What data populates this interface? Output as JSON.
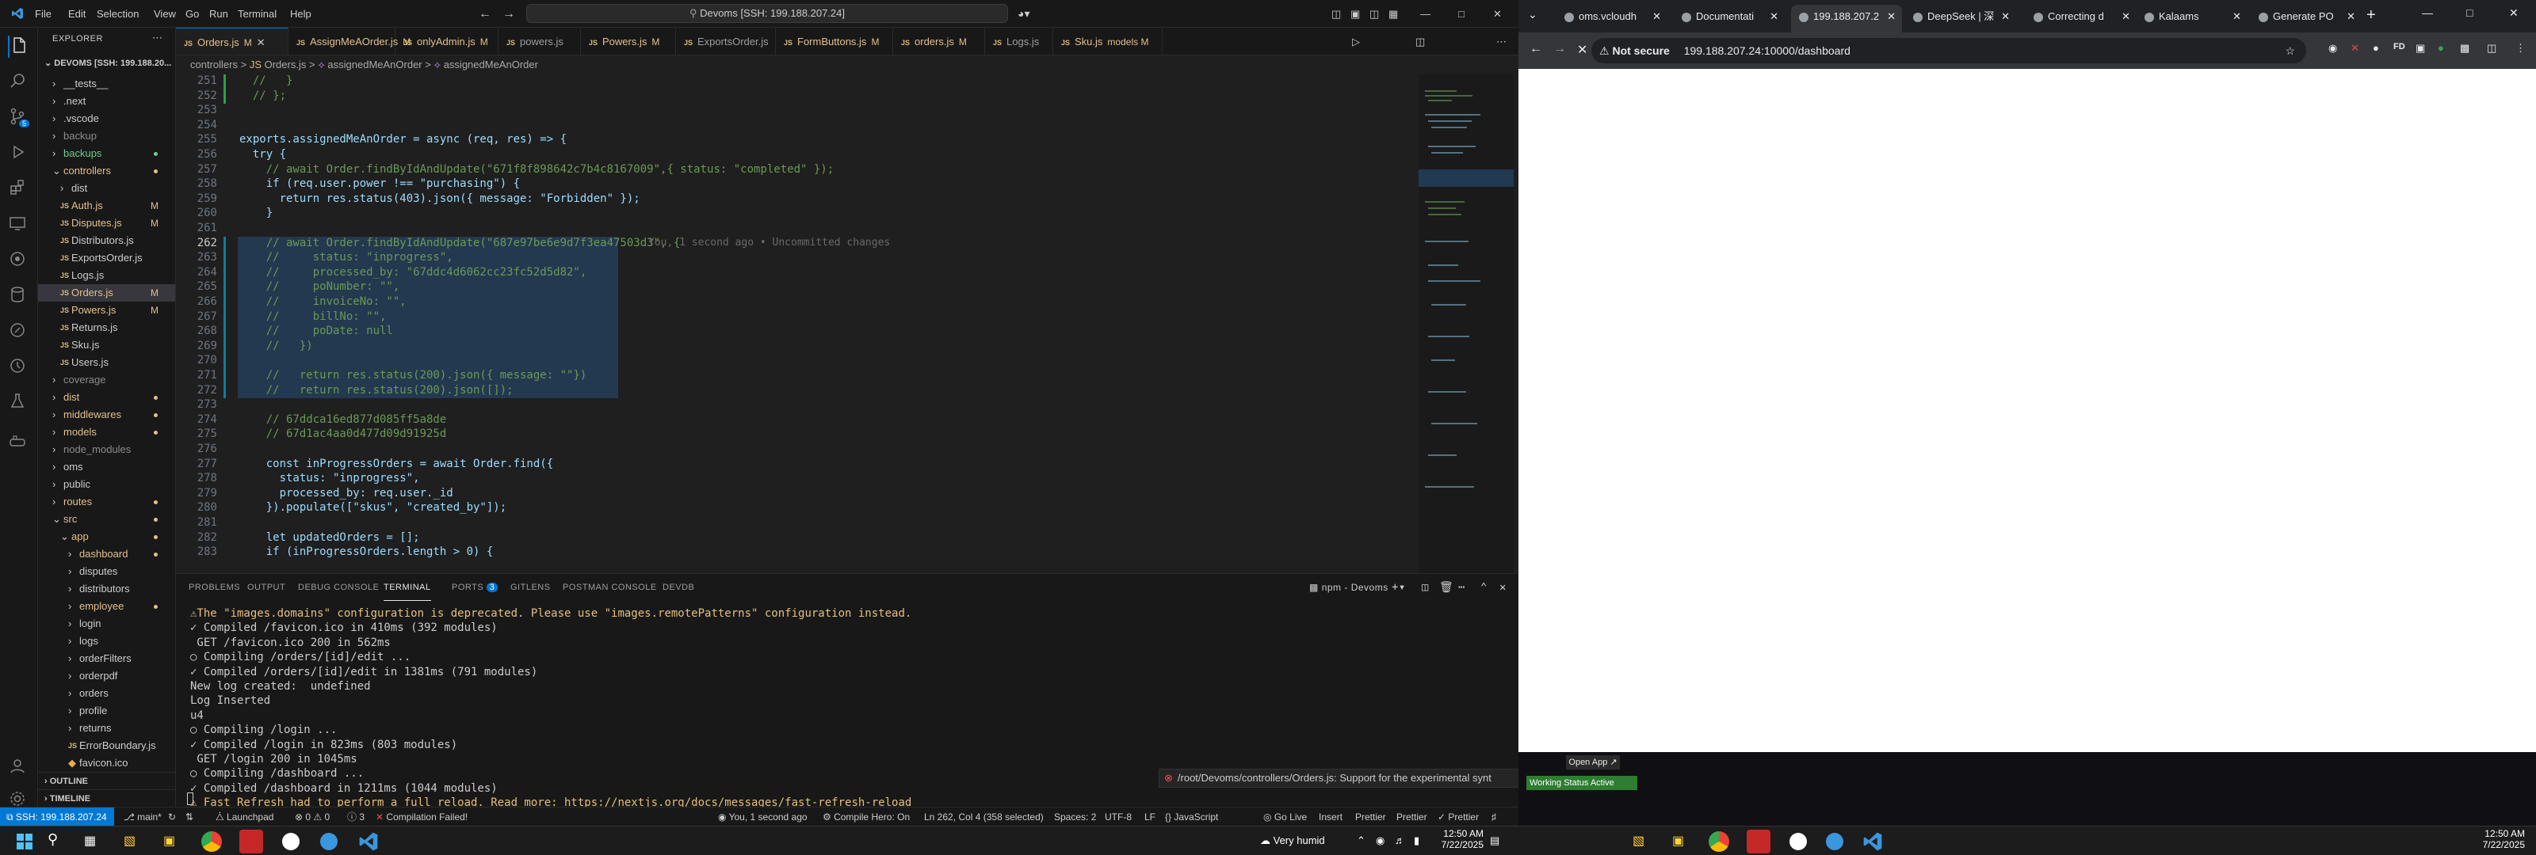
{
  "vscode": {
    "menu": [
      "File",
      "Edit",
      "Selection",
      "View",
      "Go",
      "Run",
      "Terminal",
      "Help"
    ],
    "command_center": "Devoms [SSH: 199.188.207.24]",
    "explorer": {
      "header": "EXPLORER",
      "root": "DEVOMS [SSH: 199.188.20...",
      "items": [
        {
          "label": "__tests__",
          "depth": 1,
          "type": "folder",
          "color": "#cccccc"
        },
        {
          "label": ".next",
          "depth": 1,
          "type": "folder",
          "color": "#cccccc"
        },
        {
          "label": ".vscode",
          "depth": 1,
          "type": "folder",
          "color": "#cccccc"
        },
        {
          "label": "backup",
          "depth": 1,
          "type": "folder",
          "color": "#8c8c8c"
        },
        {
          "label": "backups",
          "depth": 1,
          "type": "folder",
          "color": "#73c991"
        },
        {
          "label": "controllers",
          "depth": 1,
          "type": "folder-open",
          "color": "#e2c08d"
        },
        {
          "label": "dist",
          "depth": 2,
          "type": "folder",
          "color": "#cccccc"
        },
        {
          "label": "Auth.js",
          "depth": 2,
          "type": "js",
          "color": "#e2c08d",
          "badge": "M"
        },
        {
          "label": "Disputes.js",
          "depth": 2,
          "type": "js",
          "color": "#e2c08d",
          "badge": "M"
        },
        {
          "label": "Distributors.js",
          "depth": 2,
          "type": "js",
          "color": "#cccccc"
        },
        {
          "label": "ExportsOrder.js",
          "depth": 2,
          "type": "js",
          "color": "#cccccc"
        },
        {
          "label": "Logs.js",
          "depth": 2,
          "type": "js",
          "color": "#cccccc"
        },
        {
          "label": "Orders.js",
          "depth": 2,
          "type": "js",
          "color": "#e2c08d",
          "badge": "M",
          "selected": true
        },
        {
          "label": "Powers.js",
          "depth": 2,
          "type": "js",
          "color": "#e2c08d",
          "badge": "M"
        },
        {
          "label": "Returns.js",
          "depth": 2,
          "type": "js",
          "color": "#cccccc"
        },
        {
          "label": "Sku.js",
          "depth": 2,
          "type": "js",
          "color": "#cccccc"
        },
        {
          "label": "Users.js",
          "depth": 2,
          "type": "js",
          "color": "#cccccc"
        },
        {
          "label": "coverage",
          "depth": 1,
          "type": "folder",
          "color": "#8c8c8c"
        },
        {
          "label": "dist",
          "depth": 1,
          "type": "folder",
          "color": "#e2c08d"
        },
        {
          "label": "middlewares",
          "depth": 1,
          "type": "folder",
          "color": "#e2c08d"
        },
        {
          "label": "models",
          "depth": 1,
          "type": "folder",
          "color": "#e2c08d"
        },
        {
          "label": "node_modules",
          "depth": 1,
          "type": "folder",
          "color": "#8c8c8c"
        },
        {
          "label": "oms",
          "depth": 1,
          "type": "folder",
          "color": "#cccccc"
        },
        {
          "label": "public",
          "depth": 1,
          "type": "folder",
          "color": "#cccccc"
        },
        {
          "label": "routes",
          "depth": 1,
          "type": "folder",
          "color": "#e2c08d"
        },
        {
          "label": "src",
          "depth": 1,
          "type": "folder-open",
          "color": "#e2c08d"
        },
        {
          "label": "app",
          "depth": 2,
          "type": "folder-open",
          "color": "#e2c08d"
        },
        {
          "label": "dashboard",
          "depth": 3,
          "type": "folder",
          "color": "#e2c08d"
        },
        {
          "label": "disputes",
          "depth": 3,
          "type": "folder",
          "color": "#cccccc"
        },
        {
          "label": "distributors",
          "depth": 3,
          "type": "folder",
          "color": "#cccccc"
        },
        {
          "label": "employee",
          "depth": 3,
          "type": "folder",
          "color": "#e2c08d"
        },
        {
          "label": "login",
          "depth": 3,
          "type": "folder",
          "color": "#cccccc"
        },
        {
          "label": "logs",
          "depth": 3,
          "type": "folder",
          "color": "#cccccc"
        },
        {
          "label": "orderFilters",
          "depth": 3,
          "type": "folder",
          "color": "#cccccc"
        },
        {
          "label": "orderpdf",
          "depth": 3,
          "type": "folder",
          "color": "#cccccc"
        },
        {
          "label": "orders",
          "depth": 3,
          "type": "folder",
          "color": "#cccccc"
        },
        {
          "label": "profile",
          "depth": 3,
          "type": "folder",
          "color": "#cccccc"
        },
        {
          "label": "returns",
          "depth": 3,
          "type": "folder",
          "color": "#cccccc"
        },
        {
          "label": "ErrorBoundary.js",
          "depth": 3,
          "type": "js",
          "color": "#cccccc"
        },
        {
          "label": "favicon.ico",
          "depth": 3,
          "type": "file",
          "color": "#cccccc"
        }
      ],
      "outline": "OUTLINE",
      "timeline": "TIMELINE"
    },
    "tabs": [
      {
        "label": "Orders.js",
        "badge": "M",
        "active": true
      },
      {
        "label": "AssignMeAOrder.js",
        "badge": "M"
      },
      {
        "label": "onlyAdmin.js",
        "badge": "M"
      },
      {
        "label": "powers.js",
        "badge": ""
      },
      {
        "label": "Powers.js",
        "badge": "M"
      },
      {
        "label": "ExportsOrder.js",
        "badge": ""
      },
      {
        "label": "FormButtons.js",
        "badge": "M"
      },
      {
        "label": "orders.js",
        "badge": "M"
      },
      {
        "label": "Logs.js",
        "badge": ""
      },
      {
        "label": "Sku.js",
        "badge": "models M"
      }
    ],
    "breadcrumbs": [
      "controllers",
      ">",
      "Orders.js",
      ">",
      "assignedMeAnOrder",
      ">",
      "assignedMeAnOrder"
    ],
    "code_lines": [
      {
        "n": "251",
        "t": "  //   }"
      },
      {
        "n": "252",
        "t": "  // };"
      },
      {
        "n": "253",
        "t": ""
      },
      {
        "n": "254",
        "t": ""
      },
      {
        "n": "255",
        "t": "exports.assignedMeAnOrder = async (req, res) => {"
      },
      {
        "n": "256",
        "t": "  try {"
      },
      {
        "n": "257",
        "t": "    // await Order.findByIdAndUpdate(\"671f8f898642c7b4c8167009\",{ status: \"completed\" });"
      },
      {
        "n": "258",
        "t": "    if (req.user.power !== \"purchasing\") {"
      },
      {
        "n": "259",
        "t": "      return res.status(403).json({ message: \"Forbidden\" });"
      },
      {
        "n": "260",
        "t": "    }"
      },
      {
        "n": "261",
        "t": ""
      },
      {
        "n": "262",
        "t": "    // await Order.findByIdAndUpdate(\"687e97be6e9d7f3ea47503d3\", {"
      },
      {
        "n": "263",
        "t": "    //     status: \"inprogress\","
      },
      {
        "n": "264",
        "t": "    //     processed_by: \"67ddc4d6062cc23fc52d5d82\","
      },
      {
        "n": "265",
        "t": "    //     poNumber: \"\","
      },
      {
        "n": "266",
        "t": "    //     invoiceNo: \"\","
      },
      {
        "n": "267",
        "t": "    //     billNo: \"\","
      },
      {
        "n": "268",
        "t": "    //     poDate: null"
      },
      {
        "n": "269",
        "t": "    //   })"
      },
      {
        "n": "270",
        "t": ""
      },
      {
        "n": "271",
        "t": "    //   return res.status(200).json({ message: \"\"})"
      },
      {
        "n": "272",
        "t": "    //   return res.status(200).json([]);"
      },
      {
        "n": "273",
        "t": ""
      },
      {
        "n": "274",
        "t": "    // 67ddca16ed877d085ff5a8de"
      },
      {
        "n": "275",
        "t": "    // 67d1ac4aa0d477d09d91925d"
      },
      {
        "n": "276",
        "t": ""
      },
      {
        "n": "277",
        "t": "    const inProgressOrders = await Order.find({"
      },
      {
        "n": "278",
        "t": "      status: \"inprogress\","
      },
      {
        "n": "279",
        "t": "      processed_by: req.user._id"
      },
      {
        "n": "280",
        "t": "    }).populate([\"skus\", \"created_by\"]);"
      },
      {
        "n": "281",
        "t": ""
      },
      {
        "n": "282",
        "t": "    let updatedOrders = [];"
      },
      {
        "n": "283",
        "t": "    if (inProgressOrders.length > 0) {"
      }
    ],
    "blame": "You, 1 second ago • Uncommitted changes",
    "panel": {
      "tabs": [
        "PROBLEMS",
        "OUTPUT",
        "DEBUG CONSOLE",
        "TERMINAL",
        "PORTS",
        "GITLENS",
        "POSTMAN CONSOLE",
        "DEVDB"
      ],
      "ports_badge": "3",
      "terminal_name": "npm - Devoms",
      "lines": [
        "⚠The \"images.domains\" configuration is deprecated. Please use \"images.remotePatterns\" configuration instead.",
        "✓ Compiled /favicon.ico in 410ms (392 modules)",
        " GET /favicon.ico 200 in 562ms",
        "○ Compiling /orders/[id]/edit ...",
        "✓ Compiled /orders/[id]/edit in 1381ms (791 modules)",
        "New log created:  undefined",
        "Log Inserted",
        "u4",
        "○ Compiling /login ...",
        "✓ Compiled /login in 823ms (803 modules)",
        " GET /login 200 in 1045ms",
        "○ Compiling /dashboard ...",
        "✓ Compiled /dashboard in 1211ms (1044 modules)",
        "⚠ Fast Refresh had to perform a full reload. Read more: https://nextjs.org/docs/messages/fast-refresh-reload",
        " GET /dashboard 200 in 175ms"
      ],
      "notification": "/root/Devoms/controllers/Orders.js: Support for the experimental synt"
    },
    "status": {
      "remote": "SSH: 199.188.207.24",
      "branch": "main*",
      "errors": "0",
      "warnings": "0",
      "info": "3",
      "compile": "Compilation Failed!",
      "launchpad": "Launchpad",
      "blame": "You, 1 second ago",
      "compile_hero": "Compile Hero: On",
      "position": "Ln 262, Col 4 (358 selected)",
      "spaces": "Spaces: 2",
      "encoding": "UTF-8",
      "eol": "LF",
      "language": "JavaScript",
      "golive": "Go Live",
      "insert": "Insert",
      "prettier": "Prettier",
      "prettier2": "Prettier",
      "prettier3": "Prettier"
    }
  },
  "chrome": {
    "tabs": [
      {
        "label": "oms.vcloudh"
      },
      {
        "label": "Documentati"
      },
      {
        "label": "199.188.207.2",
        "active": true
      },
      {
        "label": "DeepSeek | 深"
      },
      {
        "label": "Correcting d"
      },
      {
        "label": "Kalaams"
      },
      {
        "label": "Generate PO"
      }
    ],
    "security": "Not secure",
    "url": "199.188.207.24:10000/dashboard",
    "open_app": "Open App",
    "working_status": "Working Status Active"
  },
  "taskbar": {
    "weather": "Very humid",
    "time_left": "12:50 AM",
    "date_left": "7/22/2025",
    "time_right": "12:50 AM",
    "date_right": "7/22/2025"
  },
  "colors": {
    "accent": "#0078d4",
    "modified": "#e2c08d",
    "error": "#f14c4c"
  }
}
